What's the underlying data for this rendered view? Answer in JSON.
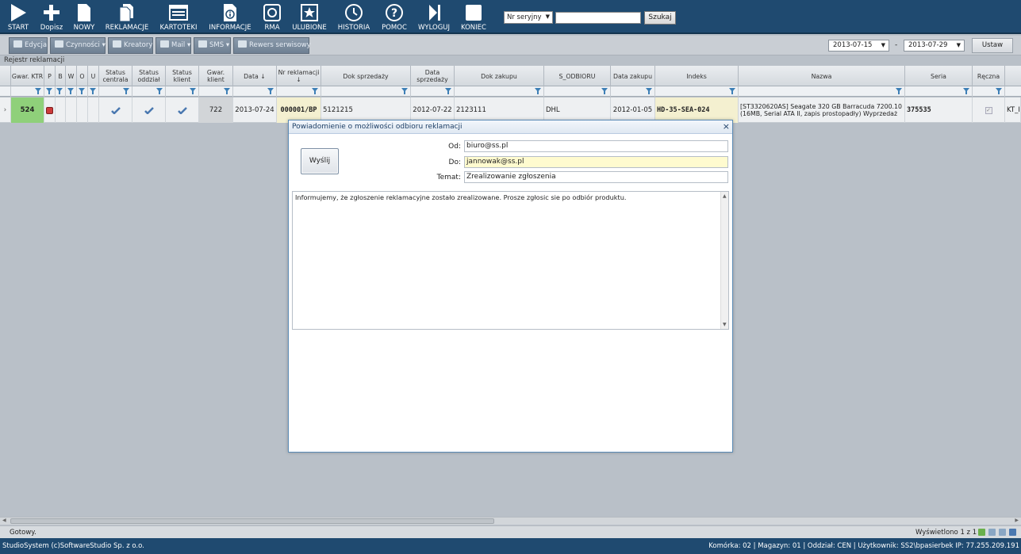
{
  "toolbar": {
    "buttons": [
      "START",
      "Dopisz",
      "NOWY",
      "REKLAMACJE",
      "KARTOTEKI",
      "INFORMACJE",
      "RMA",
      "ULUBIONE",
      "HISTORIA",
      "POMOC",
      "WYLOGUJ",
      "KONIEC"
    ],
    "search_mode": "Nr seryjny",
    "search_value": "",
    "search_button": "Szukaj"
  },
  "toolbar2": {
    "buttons": [
      "Edycja",
      "Czynności",
      "Kreatory",
      "Mail",
      "SMS",
      "Rewers serwisowy"
    ],
    "date_from": "2013-07-15",
    "date_to": "2013-07-29",
    "date_sep": "-",
    "apply_button": "Ustaw"
  },
  "register_title": "Rejestr reklamacji",
  "grid": {
    "columns": [
      "Gwar. KTR",
      "P",
      "B",
      "W",
      "O",
      "U",
      "Status centrala",
      "Status oddział",
      "Status klient",
      "Gwar. klient",
      "Data ↓",
      "Nr reklamacji ↓",
      "Dok sprzedaży",
      "Data sprzedaży",
      "Dok zakupu",
      "S_ODBIORU",
      "Data zakupu",
      "Indeks",
      "Nazwa",
      "Seria",
      "Ręczna"
    ],
    "row": {
      "expander": "›",
      "gwar_ktr": "524",
      "gwar_klient": "722",
      "data": "2013-07-24",
      "nr_reklamacji": "000001/BP",
      "dok_sprzedazy": "5121215",
      "data_sprzedazy": "2012-07-22",
      "dok_zakupu": "2123111",
      "s_odbioru": "DHL",
      "data_zakupu": "2012-01-05",
      "indeks": "HD-35-SEA-024",
      "nazwa": "[ST3320620AS] Seagate 320 GB Barracuda 7200.10 (16MB, Serial ATA II, zapis prostopadły) Wyprzedaż",
      "seria": "375535",
      "tail": "KT_I"
    }
  },
  "dialog": {
    "title": "Powiadomienie o możliwości odbioru reklamacji",
    "close": "×",
    "send_button": "Wyślij",
    "from_label": "Od:",
    "from_value": "biuro@ss.pl",
    "to_label": "Do:",
    "to_value": "jannowak@ss.pl",
    "subject_label": "Temat:",
    "subject_value": "Zrealizowanie zgłoszenia",
    "message": "Informujemy, że zgłoszenie reklamacyjne zostało zrealizowane. Prosze zgłosic sie po odbiór produktu."
  },
  "status": {
    "left": "Gotowy.",
    "right": "Wyświetlono 1 z 1"
  },
  "footer": {
    "left": "StudioSystem (c)SoftwareStudio Sp. z o.o.",
    "right": "Komórka: 02 | Magazyn: 01 | Oddział: CEN | Użytkownik: SS2\\bpasierbek IP: 77.255.209.191"
  },
  "colors": {
    "topbar": "#1f4a70",
    "accent_green": "#8fd07a",
    "highlight_yellow": "#fffbcf"
  }
}
